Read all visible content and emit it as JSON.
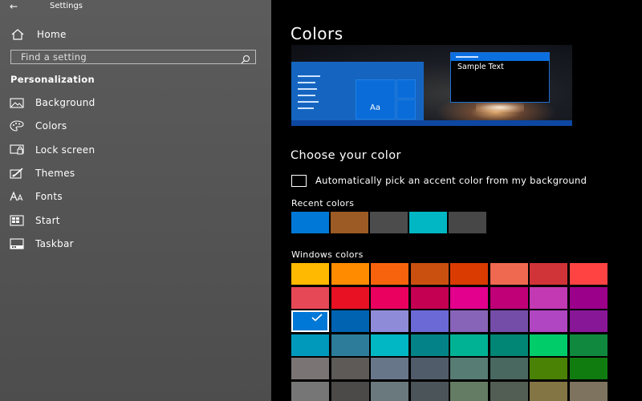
{
  "titlebar": {
    "title": "Settings",
    "back_glyph": "←"
  },
  "sidebar": {
    "home_label": "Home",
    "search_placeholder": "Find a setting",
    "section_title": "Personalization",
    "items": [
      {
        "label": "Background",
        "icon": "picture-icon"
      },
      {
        "label": "Colors",
        "icon": "palette-icon"
      },
      {
        "label": "Lock screen",
        "icon": "lock-screen-icon"
      },
      {
        "label": "Themes",
        "icon": "brush-icon"
      },
      {
        "label": "Fonts",
        "icon": "font-icon"
      },
      {
        "label": "Start",
        "icon": "start-icon"
      },
      {
        "label": "Taskbar",
        "icon": "taskbar-icon"
      }
    ]
  },
  "main": {
    "title": "Colors",
    "preview": {
      "tile_label": "Aa",
      "sample_text": "Sample Text"
    },
    "choose_title": "Choose your color",
    "auto_pick_label": "Automatically pick an accent color from my background",
    "auto_pick_checked": false,
    "recent_title": "Recent colors",
    "recent_colors": [
      "#0078d7",
      "#9c5b24",
      "#4c4c4c",
      "#00b7c3",
      "#474747"
    ],
    "windows_title": "Windows colors",
    "selected_color": "#0078d7",
    "windows_colors": [
      "#ffb900",
      "#ff8c00",
      "#f7630c",
      "#ca5010",
      "#da3b01",
      "#ef6950",
      "#d13438",
      "#ff4343",
      "#e74856",
      "#e81123",
      "#ea005e",
      "#c30052",
      "#e3008c",
      "#bf0077",
      "#c239b3",
      "#9a0089",
      "#0078d7",
      "#0063b1",
      "#8e8cd8",
      "#6b69d6",
      "#8764b8",
      "#744da9",
      "#b146c2",
      "#881798",
      "#0099bc",
      "#2d7d9a",
      "#00b7c3",
      "#038387",
      "#00b294",
      "#018574",
      "#00cc6a",
      "#10893e",
      "#7a7574",
      "#5d5a58",
      "#68768a",
      "#515c6b",
      "#567c73",
      "#486860",
      "#498205",
      "#107c10",
      "#767676",
      "#4c4a48",
      "#69797e",
      "#4a5459",
      "#647c64",
      "#525e54",
      "#847545",
      "#7e735f"
    ]
  }
}
